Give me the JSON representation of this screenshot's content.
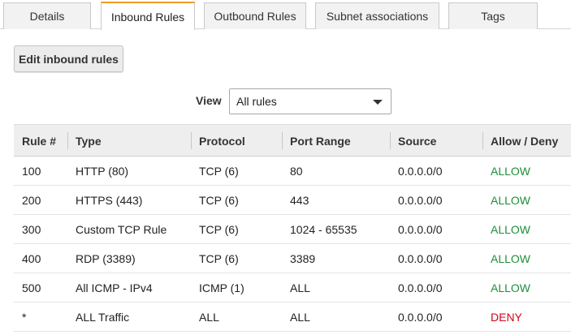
{
  "tabs": [
    {
      "label": "Details",
      "active": false
    },
    {
      "label": "Inbound Rules",
      "active": true
    },
    {
      "label": "Outbound Rules",
      "active": false
    },
    {
      "label": "Subnet associations",
      "active": false
    },
    {
      "label": "Tags",
      "active": false
    }
  ],
  "toolbar": {
    "edit_label": "Edit inbound rules"
  },
  "filter": {
    "label": "View",
    "selected": "All rules"
  },
  "table": {
    "headers": [
      "Rule #",
      "Type",
      "Protocol",
      "Port Range",
      "Source",
      "Allow / Deny"
    ],
    "rows": [
      {
        "rule": "100",
        "type": "HTTP (80)",
        "protocol": "TCP (6)",
        "port": "80",
        "source": "0.0.0.0/0",
        "action": "ALLOW"
      },
      {
        "rule": "200",
        "type": "HTTPS (443)",
        "protocol": "TCP (6)",
        "port": "443",
        "source": "0.0.0.0/0",
        "action": "ALLOW"
      },
      {
        "rule": "300",
        "type": "Custom TCP Rule",
        "protocol": "TCP (6)",
        "port": "1024 - 65535",
        "source": "0.0.0.0/0",
        "action": "ALLOW"
      },
      {
        "rule": "400",
        "type": "RDP (3389)",
        "protocol": "TCP (6)",
        "port": "3389",
        "source": "0.0.0.0/0",
        "action": "ALLOW"
      },
      {
        "rule": "500",
        "type": "All ICMP - IPv4",
        "protocol": "ICMP (1)",
        "port": "ALL",
        "source": "0.0.0.0/0",
        "action": "ALLOW"
      },
      {
        "rule": "*",
        "type": "ALL Traffic",
        "protocol": "ALL",
        "port": "ALL",
        "source": "0.0.0.0/0",
        "action": "DENY"
      }
    ]
  },
  "colors": {
    "allow": "#1e8f3a",
    "deny": "#d0021b",
    "active_tab_accent": "#f09a26"
  }
}
